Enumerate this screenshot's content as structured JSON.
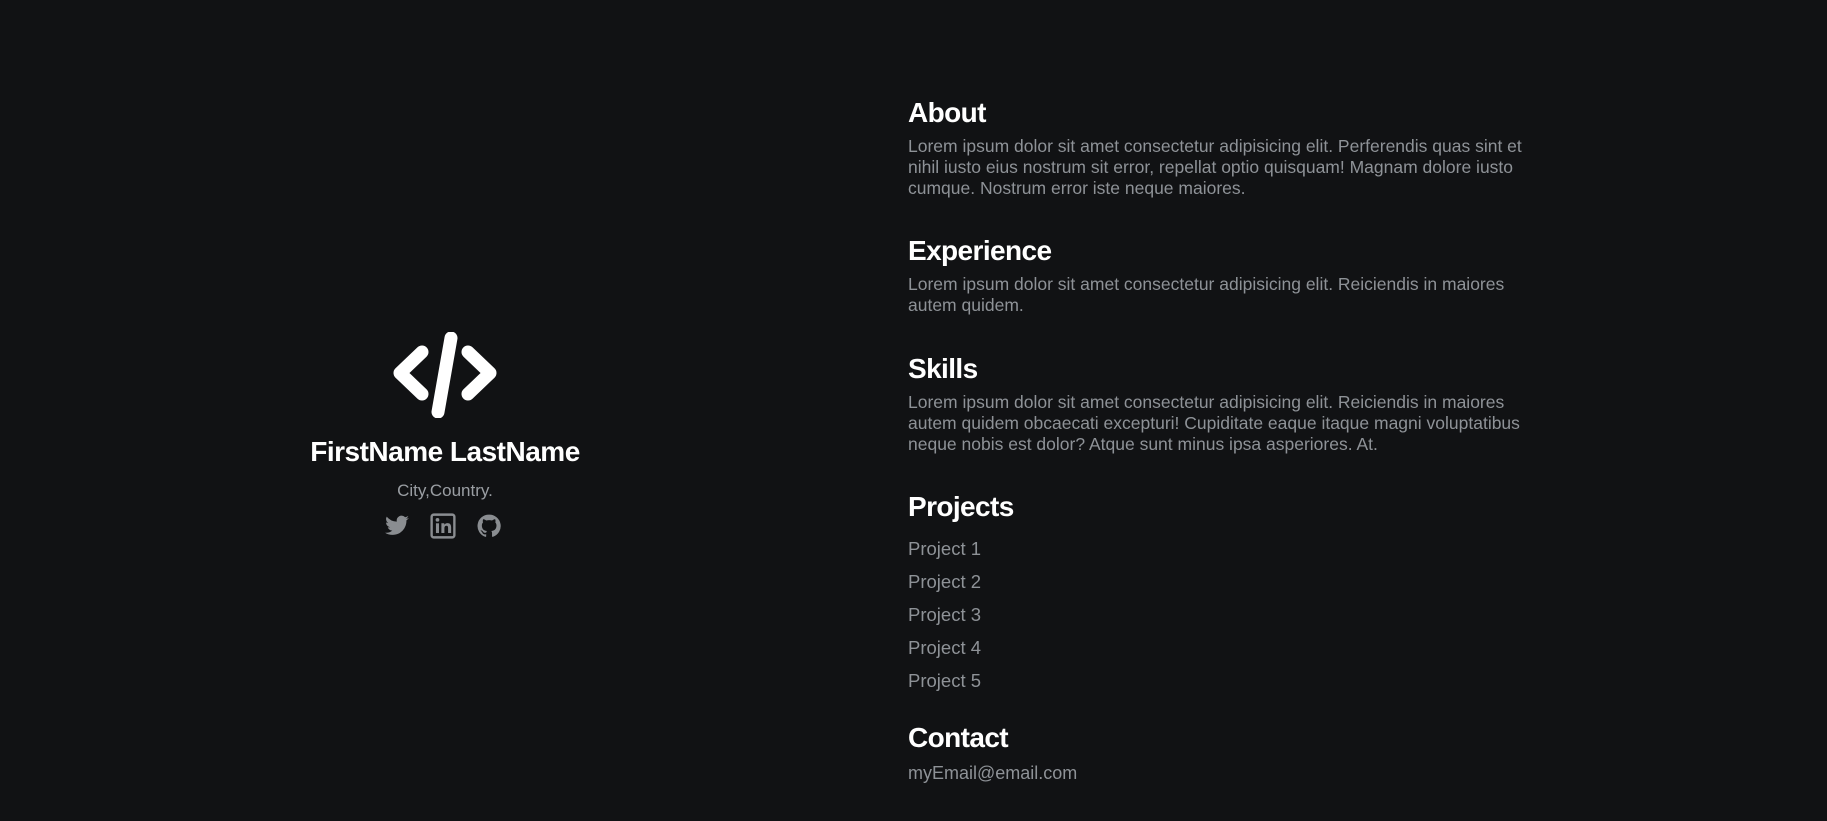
{
  "profile": {
    "name": "FirstName LastName",
    "location": "City,Country.",
    "logo_icon": "code-brackets-icon",
    "socials": [
      {
        "icon": "twitter-icon"
      },
      {
        "icon": "linkedin-icon"
      },
      {
        "icon": "github-icon"
      }
    ]
  },
  "sections": {
    "about": {
      "title": "About",
      "body": "Lorem ipsum dolor sit amet consectetur adipisicing elit. Perferendis quas sint et nihil iusto eius nostrum sit error, repellat optio quisquam! Magnam dolore iusto cumque. Nostrum error iste neque maiores."
    },
    "experience": {
      "title": "Experience",
      "body": "Lorem ipsum dolor sit amet consectetur adipisicing elit. Reiciendis in maiores autem quidem."
    },
    "skills": {
      "title": "Skills",
      "body": "Lorem ipsum dolor sit amet consectetur adipisicing elit. Reiciendis in maiores autem quidem obcaecati excepturi! Cupiditate eaque itaque magni voluptatibus neque nobis est dolor? Atque sunt minus ipsa asperiores. At."
    },
    "projects": {
      "title": "Projects",
      "items": [
        "Project 1",
        "Project 2",
        "Project 3",
        "Project 4",
        "Project 5"
      ]
    },
    "contact": {
      "title": "Contact",
      "email": "myEmail@email.com"
    }
  },
  "colors": {
    "background": "#111214",
    "heading": "#ffffff",
    "text_muted": "#8e9297",
    "icon": "#8a8d91"
  }
}
